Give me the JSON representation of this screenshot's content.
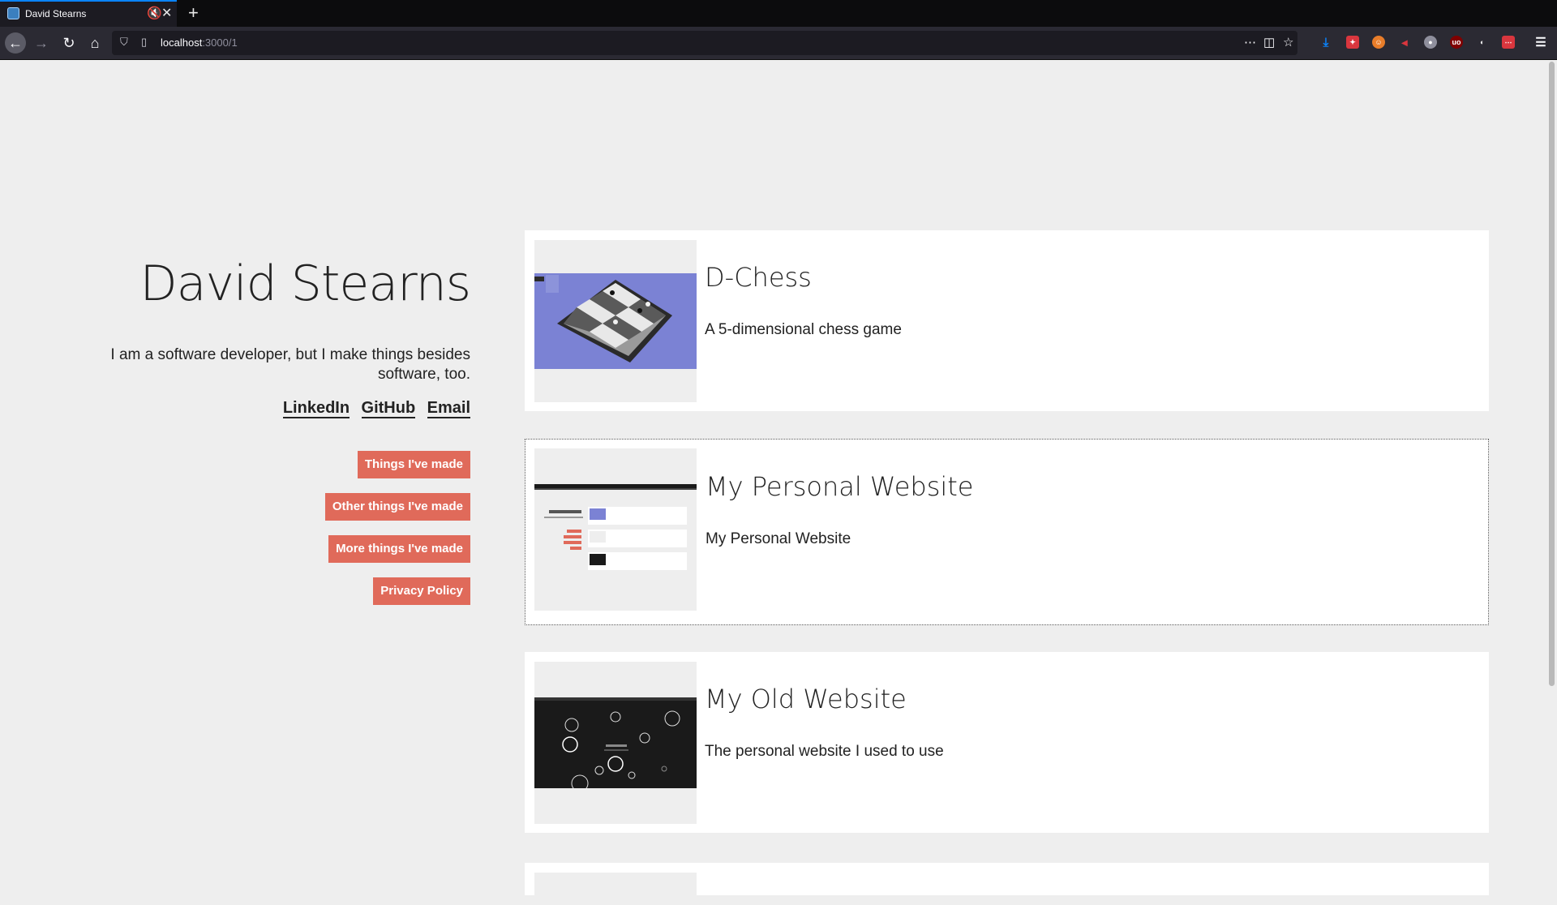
{
  "browser": {
    "tab_title": "David Stearns",
    "url_host": "localhost",
    "url_path": ":3000/1",
    "icons": [
      "back-icon",
      "forward-icon",
      "reload-icon",
      "home-icon",
      "shield-icon",
      "page-icon",
      "more-icon",
      "pocket-icon",
      "bookmark-star-icon",
      "download-icon"
    ]
  },
  "profile": {
    "name": "David Stearns",
    "bio": "I am a software developer, but I make things besides software, too.",
    "links": [
      "LinkedIn",
      "GitHub",
      "Email"
    ]
  },
  "menu": {
    "items": [
      "Things I've made",
      "Other things I've made",
      "More things I've made",
      "Privacy Policy"
    ],
    "accent_color": "#e06a5a"
  },
  "projects": [
    {
      "title": "D-Chess",
      "description": "A 5-dimensional chess game"
    },
    {
      "title": "My Personal Website",
      "description": "My Personal Website"
    },
    {
      "title": "My Old Website",
      "description": "The personal website I used to use"
    }
  ]
}
